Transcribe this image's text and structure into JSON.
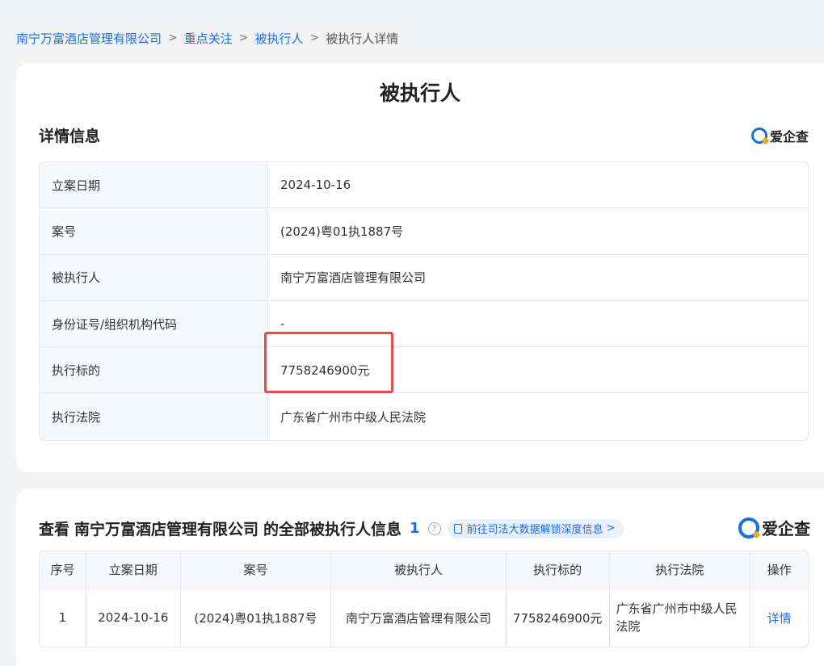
{
  "breadcrumb": {
    "items": [
      "南宁万富酒店管理有限公司",
      "重点关注",
      "被执行人"
    ],
    "current": "被执行人详情",
    "separator": ">"
  },
  "detail": {
    "title": "被执行人",
    "section_title": "详情信息",
    "brand": "爱企查",
    "rows": [
      {
        "label": "立案日期",
        "value": "2024-10-16"
      },
      {
        "label": "案号",
        "value": "(2024)粤01执1887号"
      },
      {
        "label": "被执行人",
        "value": "南宁万富酒店管理有限公司"
      },
      {
        "label": "身份证号/组织机构代码",
        "value": "-"
      },
      {
        "label": "执行标的",
        "value": "7758246900元"
      },
      {
        "label": "执行法院",
        "value": "广东省广州市中级人民法院"
      }
    ]
  },
  "list": {
    "prefix": "查看",
    "company": "南宁万富酒店管理有限公司",
    "suffix": "的全部被执行人信息",
    "count": "1",
    "help_icon": "?",
    "pill_label": "前往司法大数据解锁深度信息",
    "pill_arrow": ">",
    "brand": "爱企查",
    "columns": [
      "序号",
      "立案日期",
      "案号",
      "被执行人",
      "执行标的",
      "执行法院",
      "操作"
    ],
    "rows": [
      {
        "index": "1",
        "date": "2024-10-16",
        "case_no": "(2024)粤01执1887号",
        "party": "南宁万富酒店管理有限公司",
        "amount": "7758246900元",
        "court": "广东省广州市中级人民法院",
        "action": "详情"
      }
    ]
  },
  "colors": {
    "accent": "#1a6ee0",
    "highlight": "#e8474b",
    "background": "#f2f3f5"
  }
}
